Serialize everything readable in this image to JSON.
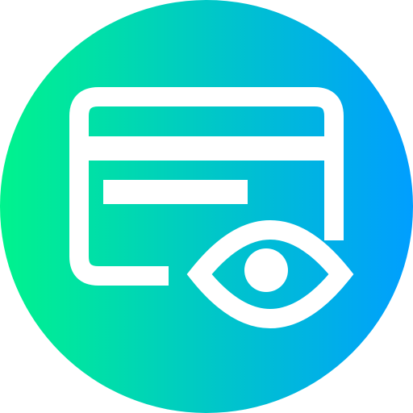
{
  "icon": {
    "name": "credit-card-view-icon",
    "gradient_start": "#00f38d",
    "gradient_end": "#009eff",
    "stroke_color": "#ffffff"
  }
}
